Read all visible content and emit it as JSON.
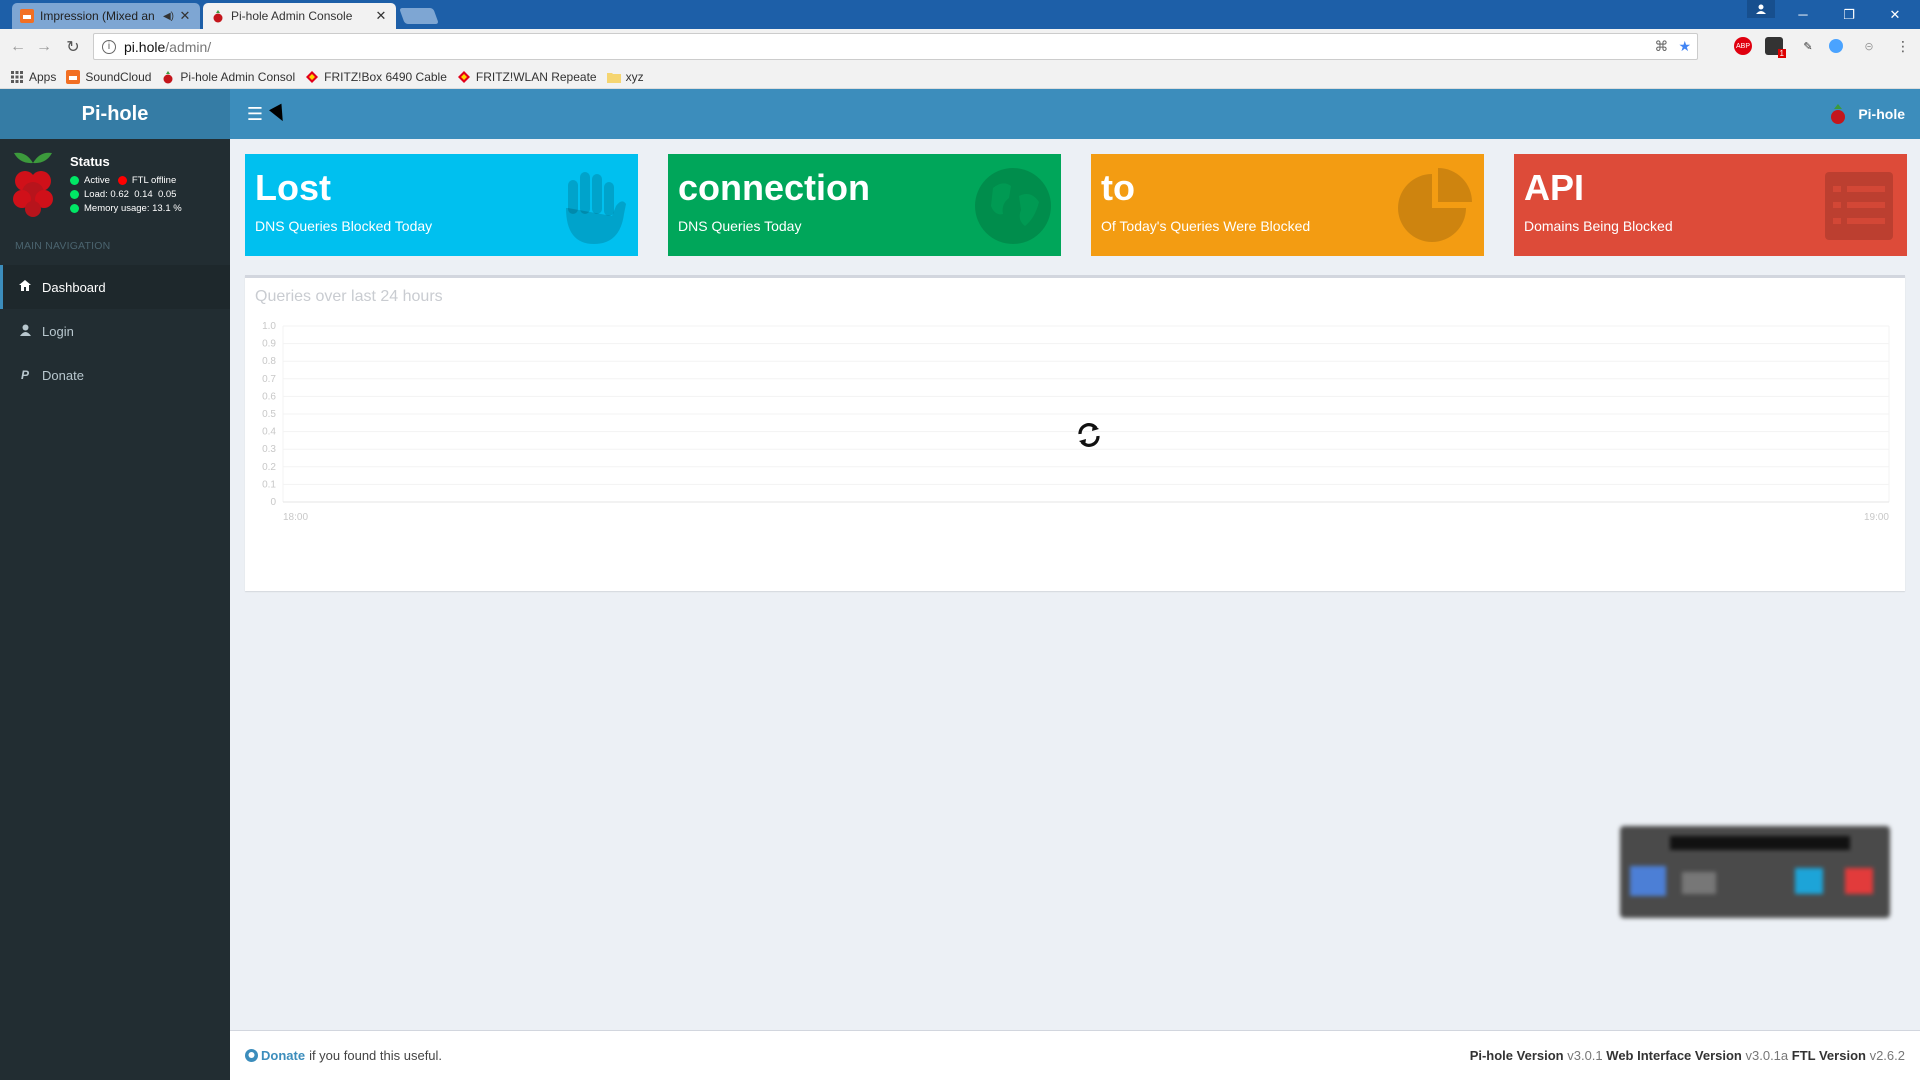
{
  "browser": {
    "tabs": [
      {
        "label": "Impression (Mixed an",
        "active": false
      },
      {
        "label": "Pi-hole Admin Console",
        "active": true
      }
    ],
    "url_host": "pi.hole",
    "url_path": "/admin/",
    "bookmarks": [
      {
        "label": "Apps",
        "icon": "apps-grid-icon"
      },
      {
        "label": "SoundCloud",
        "icon": "soundcloud-icon"
      },
      {
        "label": "Pi-hole Admin Consol",
        "icon": "pihole-icon"
      },
      {
        "label": "FRITZ!Box 6490 Cable",
        "icon": "fritz-icon"
      },
      {
        "label": "FRITZ!WLAN Repeate",
        "icon": "fritz-icon"
      },
      {
        "label": "xyz",
        "icon": "folder-icon"
      }
    ],
    "extensions": {
      "abp_label": "ABP",
      "badge_count": "1"
    }
  },
  "app": {
    "logo_text": "Pi-hole",
    "user_label": "Pi-hole",
    "sidebar": {
      "status_title": "Status",
      "status_active": "Active",
      "status_ftl": "FTL offline",
      "load_label": "Load:",
      "load_values": "0.62  0.14  0.05",
      "memory_label": "Memory usage:",
      "memory_value": "13.1 %",
      "nav_header": "MAIN NAVIGATION",
      "items": [
        {
          "label": "Dashboard",
          "icon": "home-icon",
          "active": true
        },
        {
          "label": "Login",
          "icon": "user-icon",
          "active": false
        },
        {
          "label": "Donate",
          "icon": "paypal-icon",
          "active": false
        }
      ]
    },
    "stats": [
      {
        "value": "Lost",
        "label": "DNS Queries Blocked Today",
        "color": "#00c0ef",
        "icon": "hand-icon"
      },
      {
        "value": "connection",
        "label": "DNS Queries Today",
        "color": "#00a65a",
        "icon": "globe-icon"
      },
      {
        "value": "to",
        "label": "Of Today's Queries Were Blocked",
        "color": "#f39c12",
        "icon": "pie-chart-icon"
      },
      {
        "value": "API",
        "label": "Domains Being Blocked",
        "color": "#dd4b39",
        "icon": "list-icon"
      }
    ],
    "queries_box": {
      "title": "Queries over last 24 hours"
    },
    "chart_data": {
      "type": "line",
      "title": "Queries over last 24 hours",
      "x_ticks": [
        "18:00",
        "19:00"
      ],
      "y_ticks": [
        "1.0",
        "0.9",
        "0.8",
        "0.7",
        "0.6",
        "0.5",
        "0.4",
        "0.3",
        "0.2",
        "0.1",
        "0"
      ],
      "ylim": [
        0,
        1
      ],
      "series": [],
      "grid": true
    },
    "footer": {
      "donate_link": "Donate",
      "donate_text": "if you found this useful.",
      "pihole_version_label": "Pi-hole Version",
      "pihole_version": "v3.0.1",
      "web_version_label": "Web Interface Version",
      "web_version": "v3.0.1a",
      "ftl_version_label": "FTL Version",
      "ftl_version": "v2.6.2"
    }
  }
}
